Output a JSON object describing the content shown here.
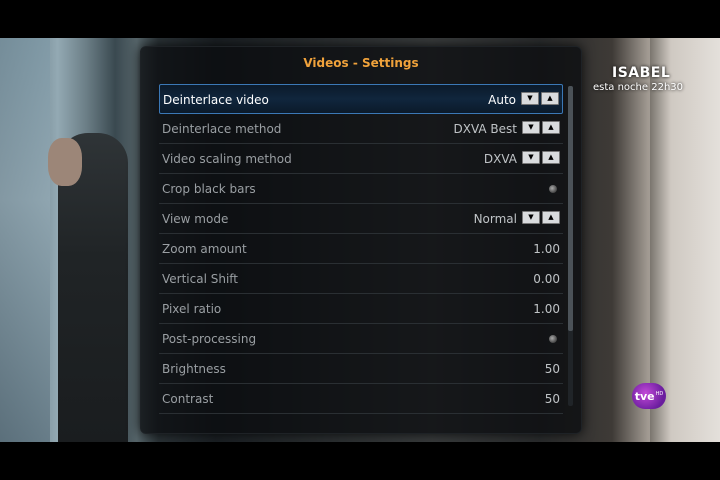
{
  "channel": {
    "program_title": "ISABEL",
    "program_time": "esta noche 22h30",
    "logo": "tve",
    "logo_badge": "HD"
  },
  "dialog": {
    "title": "Videos - Settings",
    "accent_color": "#f0a23b",
    "items": [
      {
        "label": "Deinterlace video",
        "value": "Auto",
        "control": "spinner",
        "focused": true
      },
      {
        "label": "Deinterlace method",
        "value": "DXVA Best",
        "control": "spinner"
      },
      {
        "label": "Video scaling method",
        "value": "DXVA",
        "control": "spinner"
      },
      {
        "label": "Crop black bars",
        "value": "",
        "control": "radio"
      },
      {
        "label": "View mode",
        "value": "Normal",
        "control": "spinner"
      },
      {
        "label": "Zoom amount",
        "value": "1.00",
        "control": "slider"
      },
      {
        "label": "Vertical Shift",
        "value": "0.00",
        "control": "slider"
      },
      {
        "label": "Pixel ratio",
        "value": "1.00",
        "control": "slider"
      },
      {
        "label": "Post-processing",
        "value": "",
        "control": "radio"
      },
      {
        "label": "Brightness",
        "value": "50",
        "control": "slider"
      },
      {
        "label": "Contrast",
        "value": "50",
        "control": "slider"
      }
    ]
  }
}
